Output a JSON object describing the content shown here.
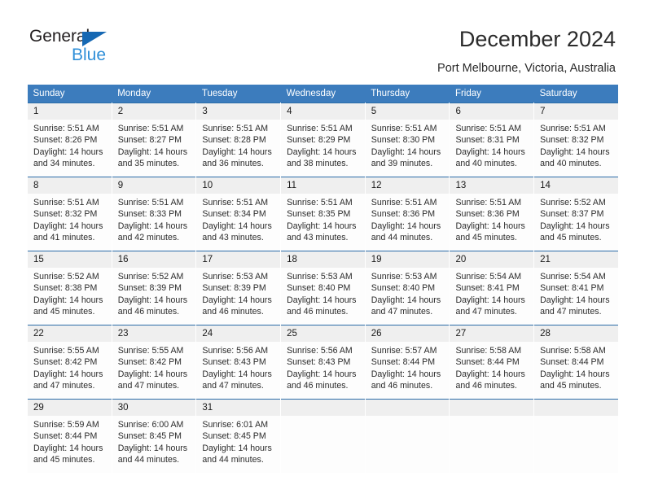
{
  "brand": {
    "name_top": "General",
    "name_bottom": "Blue",
    "triangle_icon": "triangle-icon",
    "accent_dark": "#1668b3",
    "accent_light": "#2f8fd8"
  },
  "header": {
    "title": "December 2024",
    "subtitle": "Port Melbourne, Victoria, Australia"
  },
  "theme": {
    "header_bg": "#3c7cbd",
    "header_text": "#ffffff",
    "daynum_bg": "#efefef",
    "row_divider": "#2b6ca8",
    "cell_bg": "#fdfdfd"
  },
  "weekdays": [
    "Sunday",
    "Monday",
    "Tuesday",
    "Wednesday",
    "Thursday",
    "Friday",
    "Saturday"
  ],
  "weeks": [
    [
      {
        "day": "1",
        "sunrise": "Sunrise: 5:51 AM",
        "sunset": "Sunset: 8:26 PM",
        "daylight1": "Daylight: 14 hours",
        "daylight2": "and 34 minutes."
      },
      {
        "day": "2",
        "sunrise": "Sunrise: 5:51 AM",
        "sunset": "Sunset: 8:27 PM",
        "daylight1": "Daylight: 14 hours",
        "daylight2": "and 35 minutes."
      },
      {
        "day": "3",
        "sunrise": "Sunrise: 5:51 AM",
        "sunset": "Sunset: 8:28 PM",
        "daylight1": "Daylight: 14 hours",
        "daylight2": "and 36 minutes."
      },
      {
        "day": "4",
        "sunrise": "Sunrise: 5:51 AM",
        "sunset": "Sunset: 8:29 PM",
        "daylight1": "Daylight: 14 hours",
        "daylight2": "and 38 minutes."
      },
      {
        "day": "5",
        "sunrise": "Sunrise: 5:51 AM",
        "sunset": "Sunset: 8:30 PM",
        "daylight1": "Daylight: 14 hours",
        "daylight2": "and 39 minutes."
      },
      {
        "day": "6",
        "sunrise": "Sunrise: 5:51 AM",
        "sunset": "Sunset: 8:31 PM",
        "daylight1": "Daylight: 14 hours",
        "daylight2": "and 40 minutes."
      },
      {
        "day": "7",
        "sunrise": "Sunrise: 5:51 AM",
        "sunset": "Sunset: 8:32 PM",
        "daylight1": "Daylight: 14 hours",
        "daylight2": "and 40 minutes."
      }
    ],
    [
      {
        "day": "8",
        "sunrise": "Sunrise: 5:51 AM",
        "sunset": "Sunset: 8:32 PM",
        "daylight1": "Daylight: 14 hours",
        "daylight2": "and 41 minutes."
      },
      {
        "day": "9",
        "sunrise": "Sunrise: 5:51 AM",
        "sunset": "Sunset: 8:33 PM",
        "daylight1": "Daylight: 14 hours",
        "daylight2": "and 42 minutes."
      },
      {
        "day": "10",
        "sunrise": "Sunrise: 5:51 AM",
        "sunset": "Sunset: 8:34 PM",
        "daylight1": "Daylight: 14 hours",
        "daylight2": "and 43 minutes."
      },
      {
        "day": "11",
        "sunrise": "Sunrise: 5:51 AM",
        "sunset": "Sunset: 8:35 PM",
        "daylight1": "Daylight: 14 hours",
        "daylight2": "and 43 minutes."
      },
      {
        "day": "12",
        "sunrise": "Sunrise: 5:51 AM",
        "sunset": "Sunset: 8:36 PM",
        "daylight1": "Daylight: 14 hours",
        "daylight2": "and 44 minutes."
      },
      {
        "day": "13",
        "sunrise": "Sunrise: 5:51 AM",
        "sunset": "Sunset: 8:36 PM",
        "daylight1": "Daylight: 14 hours",
        "daylight2": "and 45 minutes."
      },
      {
        "day": "14",
        "sunrise": "Sunrise: 5:52 AM",
        "sunset": "Sunset: 8:37 PM",
        "daylight1": "Daylight: 14 hours",
        "daylight2": "and 45 minutes."
      }
    ],
    [
      {
        "day": "15",
        "sunrise": "Sunrise: 5:52 AM",
        "sunset": "Sunset: 8:38 PM",
        "daylight1": "Daylight: 14 hours",
        "daylight2": "and 45 minutes."
      },
      {
        "day": "16",
        "sunrise": "Sunrise: 5:52 AM",
        "sunset": "Sunset: 8:39 PM",
        "daylight1": "Daylight: 14 hours",
        "daylight2": "and 46 minutes."
      },
      {
        "day": "17",
        "sunrise": "Sunrise: 5:53 AM",
        "sunset": "Sunset: 8:39 PM",
        "daylight1": "Daylight: 14 hours",
        "daylight2": "and 46 minutes."
      },
      {
        "day": "18",
        "sunrise": "Sunrise: 5:53 AM",
        "sunset": "Sunset: 8:40 PM",
        "daylight1": "Daylight: 14 hours",
        "daylight2": "and 46 minutes."
      },
      {
        "day": "19",
        "sunrise": "Sunrise: 5:53 AM",
        "sunset": "Sunset: 8:40 PM",
        "daylight1": "Daylight: 14 hours",
        "daylight2": "and 47 minutes."
      },
      {
        "day": "20",
        "sunrise": "Sunrise: 5:54 AM",
        "sunset": "Sunset: 8:41 PM",
        "daylight1": "Daylight: 14 hours",
        "daylight2": "and 47 minutes."
      },
      {
        "day": "21",
        "sunrise": "Sunrise: 5:54 AM",
        "sunset": "Sunset: 8:41 PM",
        "daylight1": "Daylight: 14 hours",
        "daylight2": "and 47 minutes."
      }
    ],
    [
      {
        "day": "22",
        "sunrise": "Sunrise: 5:55 AM",
        "sunset": "Sunset: 8:42 PM",
        "daylight1": "Daylight: 14 hours",
        "daylight2": "and 47 minutes."
      },
      {
        "day": "23",
        "sunrise": "Sunrise: 5:55 AM",
        "sunset": "Sunset: 8:42 PM",
        "daylight1": "Daylight: 14 hours",
        "daylight2": "and 47 minutes."
      },
      {
        "day": "24",
        "sunrise": "Sunrise: 5:56 AM",
        "sunset": "Sunset: 8:43 PM",
        "daylight1": "Daylight: 14 hours",
        "daylight2": "and 47 minutes."
      },
      {
        "day": "25",
        "sunrise": "Sunrise: 5:56 AM",
        "sunset": "Sunset: 8:43 PM",
        "daylight1": "Daylight: 14 hours",
        "daylight2": "and 46 minutes."
      },
      {
        "day": "26",
        "sunrise": "Sunrise: 5:57 AM",
        "sunset": "Sunset: 8:44 PM",
        "daylight1": "Daylight: 14 hours",
        "daylight2": "and 46 minutes."
      },
      {
        "day": "27",
        "sunrise": "Sunrise: 5:58 AM",
        "sunset": "Sunset: 8:44 PM",
        "daylight1": "Daylight: 14 hours",
        "daylight2": "and 46 minutes."
      },
      {
        "day": "28",
        "sunrise": "Sunrise: 5:58 AM",
        "sunset": "Sunset: 8:44 PM",
        "daylight1": "Daylight: 14 hours",
        "daylight2": "and 45 minutes."
      }
    ],
    [
      {
        "day": "29",
        "sunrise": "Sunrise: 5:59 AM",
        "sunset": "Sunset: 8:44 PM",
        "daylight1": "Daylight: 14 hours",
        "daylight2": "and 45 minutes."
      },
      {
        "day": "30",
        "sunrise": "Sunrise: 6:00 AM",
        "sunset": "Sunset: 8:45 PM",
        "daylight1": "Daylight: 14 hours",
        "daylight2": "and 44 minutes."
      },
      {
        "day": "31",
        "sunrise": "Sunrise: 6:01 AM",
        "sunset": "Sunset: 8:45 PM",
        "daylight1": "Daylight: 14 hours",
        "daylight2": "and 44 minutes."
      },
      {
        "day": "",
        "sunrise": "",
        "sunset": "",
        "daylight1": "",
        "daylight2": ""
      },
      {
        "day": "",
        "sunrise": "",
        "sunset": "",
        "daylight1": "",
        "daylight2": ""
      },
      {
        "day": "",
        "sunrise": "",
        "sunset": "",
        "daylight1": "",
        "daylight2": ""
      },
      {
        "day": "",
        "sunrise": "",
        "sunset": "",
        "daylight1": "",
        "daylight2": ""
      }
    ]
  ]
}
